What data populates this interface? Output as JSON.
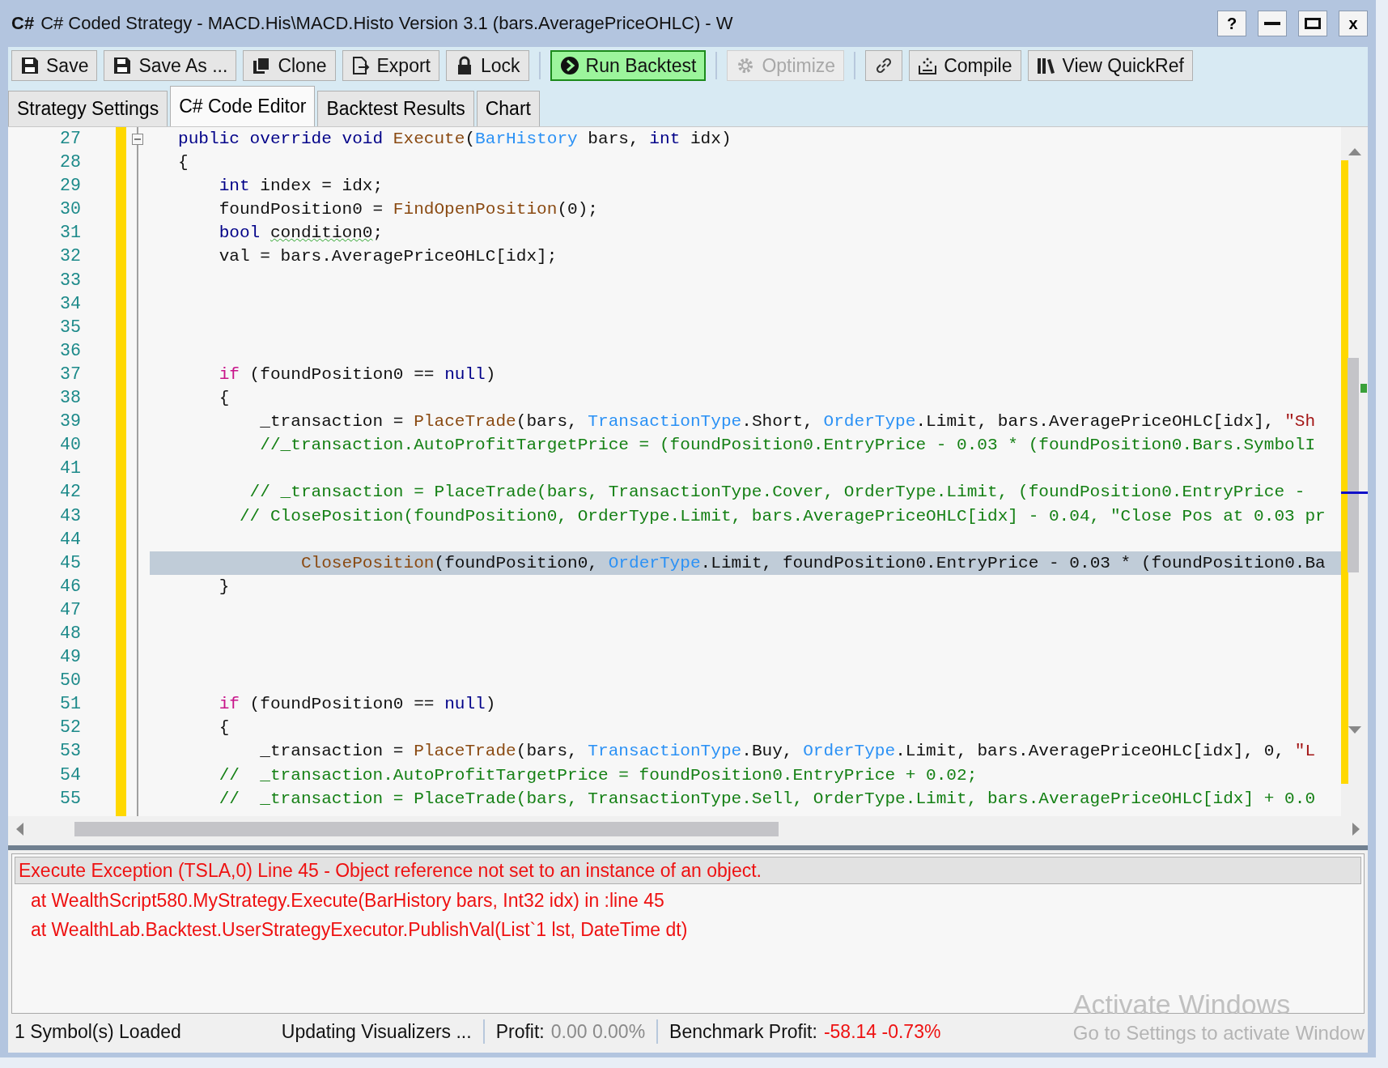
{
  "window": {
    "icon_text": "C#",
    "title": "C# Coded Strategy - MACD.His\\MACD.Histo Version 3.1 (bars.AveragePriceOHLC) - W",
    "help": "?",
    "close": "x"
  },
  "toolbar": {
    "groups": [
      [
        {
          "label": "Save",
          "disabled": false,
          "accent": false
        },
        {
          "label": "Save As ...",
          "disabled": false,
          "accent": false
        },
        {
          "label": "Clone",
          "disabled": false,
          "accent": false
        },
        {
          "label": "Export",
          "disabled": false,
          "accent": false
        },
        {
          "label": "Lock",
          "disabled": false,
          "accent": false
        }
      ],
      [
        {
          "label": "Run Backtest",
          "disabled": false,
          "accent": true
        }
      ],
      [
        {
          "label": "Optimize",
          "disabled": true,
          "accent": false
        }
      ],
      [
        {
          "disabled": false,
          "accent": false
        },
        {
          "label": "Compile",
          "disabled": false,
          "accent": false
        },
        {
          "label": "View QuickRef",
          "disabled": false,
          "accent": false
        }
      ]
    ]
  },
  "tabs": [
    {
      "label": "Strategy Settings",
      "selected": false
    },
    {
      "label": "C# Code Editor",
      "selected": true
    },
    {
      "label": "Backtest Results",
      "selected": false
    },
    {
      "label": "Chart",
      "selected": false
    }
  ],
  "editor": {
    "lines": [
      {
        "number": "27",
        "current": false,
        "folder": true,
        "tokens": [
          {
            "kind": "keyword",
            "text": "public override void "
          },
          {
            "kind": "method",
            "text": "Execute"
          },
          {
            "kind": "plain",
            "text": "("
          },
          {
            "kind": "type",
            "text": "BarHistory"
          },
          {
            "kind": "plain",
            "text": " bars, "
          },
          {
            "kind": "keyword",
            "text": "int"
          },
          {
            "kind": "plain",
            "text": " idx)"
          }
        ]
      },
      {
        "number": "28",
        "current": false,
        "folder": false,
        "tokens": [
          {
            "kind": "plain",
            "text": "{"
          }
        ]
      },
      {
        "number": "29",
        "current": false,
        "folder": false,
        "tokens": [
          {
            "kind": "keyword",
            "text": "    int"
          },
          {
            "kind": "plain",
            "text": " index = idx;"
          }
        ]
      },
      {
        "number": "30",
        "current": false,
        "folder": false,
        "tokens": [
          {
            "kind": "plain",
            "text": "    foundPosition0 = "
          },
          {
            "kind": "method",
            "text": "FindOpenPosition"
          },
          {
            "kind": "plain",
            "text": "(0);"
          }
        ]
      },
      {
        "number": "31",
        "current": false,
        "folder": false,
        "tokens": [
          {
            "kind": "keyword",
            "text": "    bool "
          },
          {
            "kind": "warning",
            "text": "condition0"
          },
          {
            "kind": "plain",
            "text": ";"
          }
        ]
      },
      {
        "number": "32",
        "current": false,
        "folder": false,
        "tokens": [
          {
            "kind": "plain",
            "text": "    val = bars.AveragePriceOHLC[idx];"
          }
        ]
      },
      {
        "number": "33",
        "current": false,
        "folder": false
      },
      {
        "number": "34",
        "current": false,
        "folder": false
      },
      {
        "number": "35",
        "current": false,
        "folder": false
      },
      {
        "number": "36",
        "current": false,
        "folder": false
      },
      {
        "number": "37",
        "current": false,
        "folder": false,
        "tokens": [
          {
            "kind": "control",
            "text": "    if"
          },
          {
            "kind": "plain",
            "text": " (foundPosition0 == "
          },
          {
            "kind": "keyword",
            "text": "null"
          },
          {
            "kind": "plain",
            "text": ")"
          }
        ]
      },
      {
        "number": "38",
        "current": false,
        "folder": false,
        "tokens": [
          {
            "kind": "plain",
            "text": "    {"
          }
        ]
      },
      {
        "number": "39",
        "current": false,
        "folder": false,
        "tokens": [
          {
            "kind": "plain",
            "text": "        _transaction = "
          },
          {
            "kind": "method",
            "text": "PlaceTrade"
          },
          {
            "kind": "plain",
            "text": "(bars, "
          },
          {
            "kind": "type",
            "text": "TransactionType"
          },
          {
            "kind": "plain",
            "text": ".Short, "
          },
          {
            "kind": "type",
            "text": "OrderType"
          },
          {
            "kind": "plain",
            "text": ".Limit, bars.AveragePriceOHLC[idx], "
          },
          {
            "kind": "string",
            "text": "\"Sh"
          }
        ]
      },
      {
        "number": "40",
        "current": false,
        "folder": false,
        "tokens": [
          {
            "kind": "comment",
            "text": "        //_transaction.AutoProfitTargetPrice = (foundPosition0.EntryPrice - 0.03 * (foundPosition0.Bars.SymbolI"
          }
        ]
      },
      {
        "number": "41",
        "current": false,
        "folder": false
      },
      {
        "number": "42",
        "current": false,
        "folder": false,
        "tokens": [
          {
            "kind": "comment",
            "text": "       // _transaction = PlaceTrade(bars, TransactionType.Cover, OrderType.Limit, (foundPosition0.EntryPrice -"
          }
        ]
      },
      {
        "number": "43",
        "current": false,
        "folder": false,
        "tokens": [
          {
            "kind": "comment",
            "text": "      // ClosePosition(foundPosition0, OrderType.Limit, bars.AveragePriceOHLC[idx] - 0.04, \"Close Pos at 0.03 pr"
          }
        ]
      },
      {
        "number": "44",
        "current": false,
        "folder": false
      },
      {
        "number": "45",
        "current": true,
        "folder": false,
        "tokens": [
          {
            "kind": "method",
            "text": "            ClosePosition"
          },
          {
            "kind": "plain",
            "text": "(foundPosition0, "
          },
          {
            "kind": "type",
            "text": "OrderType"
          },
          {
            "kind": "plain",
            "text": ".Limit, foundPosition0.EntryPrice - 0.03 * (foundPosition0.Ba"
          }
        ]
      },
      {
        "number": "46",
        "current": false,
        "folder": false,
        "tokens": [
          {
            "kind": "plain",
            "text": "    }"
          }
        ]
      },
      {
        "number": "47",
        "current": false,
        "folder": false
      },
      {
        "number": "48",
        "current": false,
        "folder": false
      },
      {
        "number": "49",
        "current": false,
        "folder": false
      },
      {
        "number": "50",
        "current": false,
        "folder": false
      },
      {
        "number": "51",
        "current": false,
        "folder": false,
        "tokens": [
          {
            "kind": "control",
            "text": "    if"
          },
          {
            "kind": "plain",
            "text": " (foundPosition0 == "
          },
          {
            "kind": "keyword",
            "text": "null"
          },
          {
            "kind": "plain",
            "text": ")"
          }
        ]
      },
      {
        "number": "52",
        "current": false,
        "folder": false,
        "tokens": [
          {
            "kind": "plain",
            "text": "    {"
          }
        ]
      },
      {
        "number": "53",
        "current": false,
        "folder": false,
        "tokens": [
          {
            "kind": "plain",
            "text": "        _transaction = "
          },
          {
            "kind": "method",
            "text": "PlaceTrade"
          },
          {
            "kind": "plain",
            "text": "(bars, "
          },
          {
            "kind": "type",
            "text": "TransactionType"
          },
          {
            "kind": "plain",
            "text": ".Buy, "
          },
          {
            "kind": "type",
            "text": "OrderType"
          },
          {
            "kind": "plain",
            "text": ".Limit, bars.AveragePriceOHLC[idx], 0, "
          },
          {
            "kind": "string",
            "text": "\"L"
          }
        ]
      },
      {
        "number": "54",
        "current": false,
        "folder": false,
        "tokens": [
          {
            "kind": "comment",
            "text": "    //  _transaction.AutoProfitTargetPrice = foundPosition0.EntryPrice + 0.02;"
          }
        ]
      },
      {
        "number": "55",
        "current": false,
        "folder": false,
        "tokens": [
          {
            "kind": "comment",
            "text": "    //  _transaction = PlaceTrade(bars, TransactionType.Sell, OrderType.Limit, bars.AveragePriceOHLC[idx] + 0.0"
          }
        ]
      }
    ]
  },
  "output": {
    "lines": [
      {
        "text": "Execute Exception (TSLA,0) Line 45 - Object reference not set to an instance of an object.",
        "selected": true
      },
      {
        "text": "at WealthScript580.MyStrategy.Execute(BarHistory bars, Int32 idx) in :line 45",
        "selected": false
      },
      {
        "text": "at WealthLab.Backtest.UserStrategyExecutor.PublishVal(List`1 lst, DateTime dt)",
        "selected": false
      }
    ]
  },
  "status_bar": {
    "symbols": "1 Symbol(s) Loaded",
    "activity": "Updating Visualizers ...",
    "profit_label": "Profit:",
    "profit_values": "0.00 0.00%",
    "benchmark_label": "Benchmark Profit:",
    "benchmark_values": "-58.14 -0.73%"
  },
  "activation_notice": {
    "title": "Activate Windows",
    "subtitle": "Go to Settings to activate Window"
  }
}
